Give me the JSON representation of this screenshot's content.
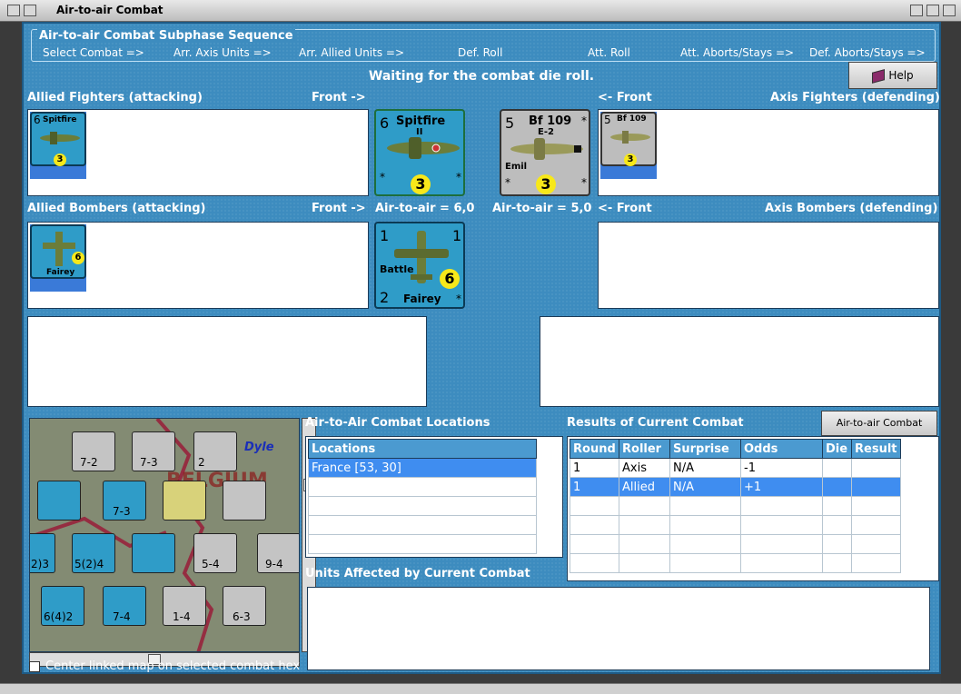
{
  "window": {
    "title": "Air-to-air Combat"
  },
  "sequence": {
    "title": "Air-to-air Combat Subphase Sequence",
    "steps": [
      "Select Combat =>",
      "Arr. Axis Units =>",
      "Arr. Allied Units =>",
      "Def. Roll",
      "Att. Roll",
      "Att. Aborts/Stays =>",
      "Def. Aborts/Stays =>"
    ]
  },
  "status_text": "Waiting for the combat die roll.",
  "help_button": "Help",
  "labels": {
    "allied_fighters": "Allied Fighters (attacking)",
    "front_right": "Front ->",
    "front_left": "<- Front",
    "axis_fighters": "Axis Fighters (defending)",
    "allied_bombers": "Allied Bombers (attacking)",
    "front_right2": "Front ->",
    "air_allied": "Air-to-air = 6,0",
    "air_axis": "Air-to-air = 5,0",
    "front_left2": "<- Front",
    "axis_bombers": "Axis Bombers (defending)"
  },
  "units": {
    "spitfire": {
      "value": "6",
      "name": "Spitfire",
      "sub": "II",
      "range": "3",
      "star": "*"
    },
    "bf109": {
      "value": "5",
      "name": "Bf 109",
      "sub": "E-2",
      "nick": "Emil",
      "range": "3",
      "star": "*"
    },
    "fairey": {
      "top_left": "1",
      "top_right": "1",
      "name": "Battle",
      "maker": "Fairey",
      "bottom_left": "2",
      "range": "6",
      "star": "*"
    }
  },
  "map": {
    "center_label": "Center linked map on selected combat hex",
    "tiles": [
      {
        "v": "7-2"
      },
      {
        "v": "7-3"
      },
      {
        "v": "2"
      },
      {
        "v": "7-3"
      },
      {
        "v": "5(2)4"
      },
      {
        "v": "5-4"
      },
      {
        "v": "9-4"
      },
      {
        "v": "6(4)2"
      },
      {
        "v": "7-4"
      },
      {
        "v": "1-4"
      },
      {
        "v": "6-3"
      },
      {
        "v": "2)3"
      }
    ],
    "map_text": [
      "Dyle",
      "BELGIUM"
    ]
  },
  "locations": {
    "title": "Air-to-Air Combat Locations",
    "header": "Locations",
    "rows": [
      "France [53, 30]",
      "",
      "",
      "",
      ""
    ]
  },
  "results": {
    "title": "Results of Current Combat",
    "chart_button": "Air-to-air Combat Chart",
    "headers": [
      "Round",
      "Roller",
      "Surprise",
      "Odds",
      "Die",
      "Result"
    ],
    "rows": [
      [
        "1",
        "Axis",
        "N/A",
        "-1",
        "",
        ""
      ],
      [
        "1",
        "Allied",
        "N/A",
        "+1",
        "",
        ""
      ],
      [
        "",
        "",
        "",
        "",
        "",
        ""
      ],
      [
        "",
        "",
        "",
        "",
        "",
        ""
      ],
      [
        "",
        "",
        "",
        "",
        "",
        ""
      ],
      [
        "",
        "",
        "",
        "",
        "",
        ""
      ]
    ]
  },
  "affected": {
    "title": "Units Affected by Current Combat"
  },
  "colors": {
    "panel": "#3d8cbf",
    "british": "#2f9cc8",
    "german": "#bdbdbd",
    "selection": "#3f8df0"
  }
}
